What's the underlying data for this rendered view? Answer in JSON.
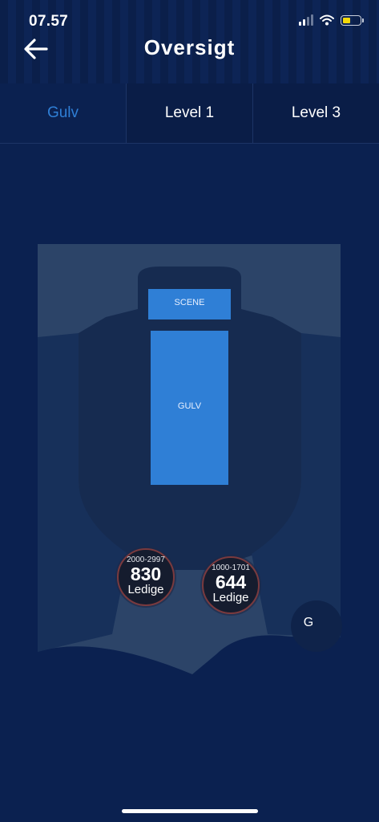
{
  "status_bar": {
    "time": "07.57"
  },
  "header": {
    "title": "Oversigt",
    "back_icon": "arrow-left-icon"
  },
  "tabs": [
    {
      "label": "Gulv",
      "active": true
    },
    {
      "label": "Level 1",
      "active": false
    },
    {
      "label": "Level 3",
      "active": false
    }
  ],
  "map": {
    "stage_label": "SCENE",
    "floor_label": "GULV",
    "entrance_label": "G",
    "sections": [
      {
        "range": "2000-2997",
        "available": "830",
        "available_label": "Ledige"
      },
      {
        "range": "1000-1701",
        "available": "644",
        "available_label": "Ledige"
      }
    ]
  },
  "colors": {
    "background": "#0b2150",
    "active_tab": "#2f7fd6",
    "floor_section": "#2f7fd6",
    "venue_outer": "#2c4468",
    "venue_inner": "#162b50",
    "battery": "#f5d90a"
  }
}
